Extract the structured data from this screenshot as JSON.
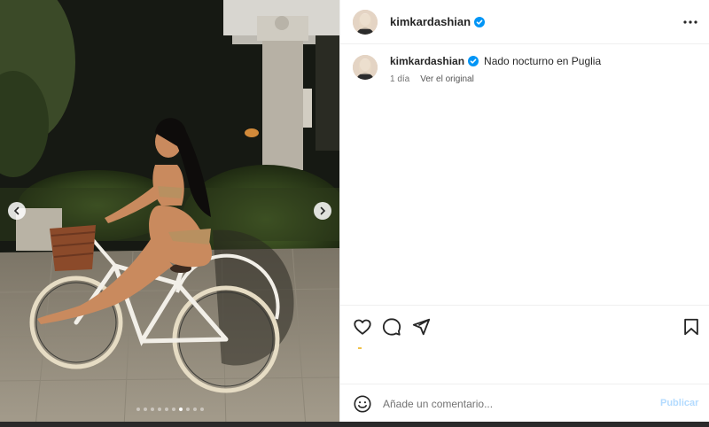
{
  "post": {
    "username": "kimkardashian",
    "verified": true,
    "caption_text": "Nado nocturno en Puglia",
    "time_ago": "1 día",
    "see_original": "Ver el original",
    "date_mark": "",
    "likes_visible": false
  },
  "carousel": {
    "dot_count": 10,
    "active_index": 6
  },
  "comment": {
    "placeholder": "Añade un comentario...",
    "publish_label": "Publicar"
  },
  "colors": {
    "verified_blue": "#0095f6",
    "publish_disabled": "#b3dbff",
    "text_primary": "#262626",
    "text_secondary": "#737373"
  },
  "icons": {
    "header": [
      "more-options-icon"
    ],
    "actions": [
      "heart-icon",
      "comment-icon",
      "share-icon",
      "bookmark-icon"
    ],
    "comment": [
      "emoji-icon"
    ],
    "carousel": [
      "chevron-left-icon",
      "chevron-right-icon"
    ]
  }
}
